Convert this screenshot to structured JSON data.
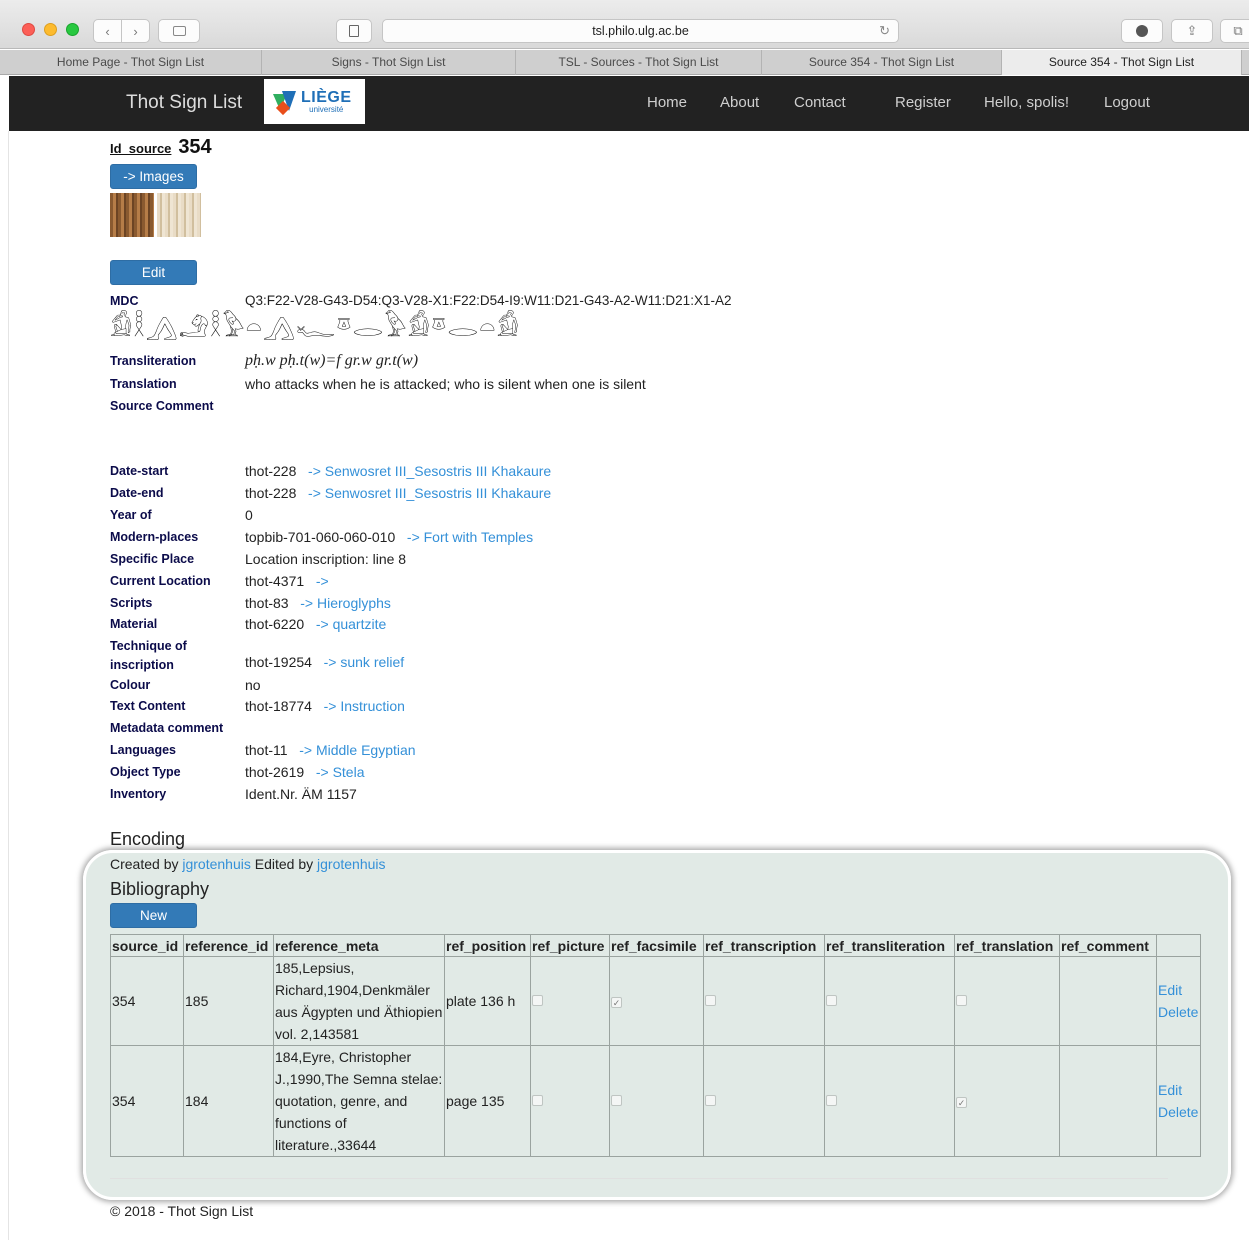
{
  "browser": {
    "url": "tsl.philo.ulg.ac.be",
    "tabs": [
      {
        "label": "Home Page - Thot Sign List",
        "active": false
      },
      {
        "label": "Signs - Thot Sign List",
        "active": false
      },
      {
        "label": "TSL - Sources - Thot Sign List",
        "active": false
      },
      {
        "label": "Source 354 - Thot Sign List",
        "active": false
      },
      {
        "label": "Source 354 - Thot Sign List",
        "active": true
      }
    ]
  },
  "navbar": {
    "brand": "Thot Sign List",
    "logo_text": "LIÈGE",
    "logo_subtext": "université",
    "links": [
      "Home",
      "About",
      "Contact",
      "Register",
      "Hello, spolis!",
      "Logout"
    ]
  },
  "source": {
    "id_label": "Id_source",
    "id_value": "354",
    "images_button": "-> Images",
    "edit_button": "Edit"
  },
  "mdc": {
    "label": "MDC",
    "value": "Q3:F22-V28-G43-D54:Q3-V28-X1:F22:D54-I9:W11:D21-G43-A2-W11:D21:X1-A2",
    "glyphs": "𓀁𓎛𓂻𓄂𓎛𓅱𓏏𓂻𓆑𓎼𓂋𓅱𓀁𓎼𓂋𓏏𓀁"
  },
  "text_fields": {
    "transliteration_label": "Transliteration",
    "transliteration_value": "pḥ.w pḥ.t(w)=f gr.w gr.t(w)",
    "translation_label": "Translation",
    "translation_value": "who attacks when he is attacked; who is silent when one is silent",
    "source_comment_label": "Source Comment"
  },
  "metadata": [
    {
      "label": "Date-start",
      "code": "thot-228",
      "link": "-> Senwosret III_Sesostris III Khakaure"
    },
    {
      "label": "Date-end",
      "code": "thot-228",
      "link": "-> Senwosret III_Sesostris III Khakaure"
    },
    {
      "label": "Year of",
      "code": "0",
      "link": ""
    },
    {
      "label": "Modern-places",
      "code": "topbib-701-060-060-010",
      "link": "-> Fort with Temples"
    },
    {
      "label": "Specific Place",
      "code": "Location inscription: line 8",
      "link": ""
    },
    {
      "label": "Current Location",
      "code": "thot-4371",
      "link": "->"
    },
    {
      "label": "Scripts",
      "code": "thot-83",
      "link": "-> Hieroglyphs"
    },
    {
      "label": "Material",
      "code": "thot-6220",
      "link": "-> quartzite"
    },
    {
      "label": "Technique of inscription",
      "code": "thot-19254",
      "link": "-> sunk relief"
    },
    {
      "label": "Colour",
      "code": "no",
      "link": ""
    },
    {
      "label": "Text Content",
      "code": "thot-18774",
      "link": "-> Instruction"
    },
    {
      "label": "Metadata comment",
      "code": "",
      "link": ""
    },
    {
      "label": "Languages",
      "code": "thot-11",
      "link": "-> Middle Egyptian"
    },
    {
      "label": "Object Type",
      "code": "thot-2619",
      "link": "-> Stela"
    },
    {
      "label": "Inventory",
      "code": "Ident.Nr. ÄM 1157",
      "link": ""
    }
  ],
  "encoding": {
    "heading": "Encoding",
    "created_prefix": "Created by ",
    "created_by": "jgrotenhuis",
    "edited_prefix": " Edited by ",
    "edited_by": "jgrotenhuis"
  },
  "bibliography": {
    "heading": "Bibliography",
    "new_button": "New",
    "columns": [
      "source_id",
      "reference_id",
      "reference_meta",
      "ref_position",
      "ref_picture",
      "ref_facsimile",
      "ref_transcription",
      "ref_transliteration",
      "ref_translation",
      "ref_comment",
      ""
    ],
    "rows": [
      {
        "source_id": "354",
        "reference_id": "185",
        "reference_meta": "185,Lepsius, Richard,1904,Denkmäler aus Ägypten und Äthiopien vol. 2,143581",
        "ref_position": "plate 136 h",
        "ref_picture": false,
        "ref_facsimile": true,
        "ref_transcription": false,
        "ref_transliteration": false,
        "ref_translation": false,
        "ref_comment": "",
        "edit": "Edit",
        "delete": "Delete"
      },
      {
        "source_id": "354",
        "reference_id": "184",
        "reference_meta": "184,Eyre, Christopher J.,1990,The Semna stelae: quotation, genre, and functions of literature.,33644",
        "ref_position": "page 135",
        "ref_picture": false,
        "ref_facsimile": false,
        "ref_transcription": false,
        "ref_transliteration": false,
        "ref_translation": true,
        "ref_comment": "",
        "edit": "Edit",
        "delete": "Delete"
      }
    ]
  },
  "footer": "© 2018 - Thot Sign List",
  "colors": {
    "navbar_bg": "#222222",
    "button_primary": "#337ab7",
    "link": "#3490d8",
    "label": "#0b0b4a",
    "highlight": "#c8d8d2"
  }
}
